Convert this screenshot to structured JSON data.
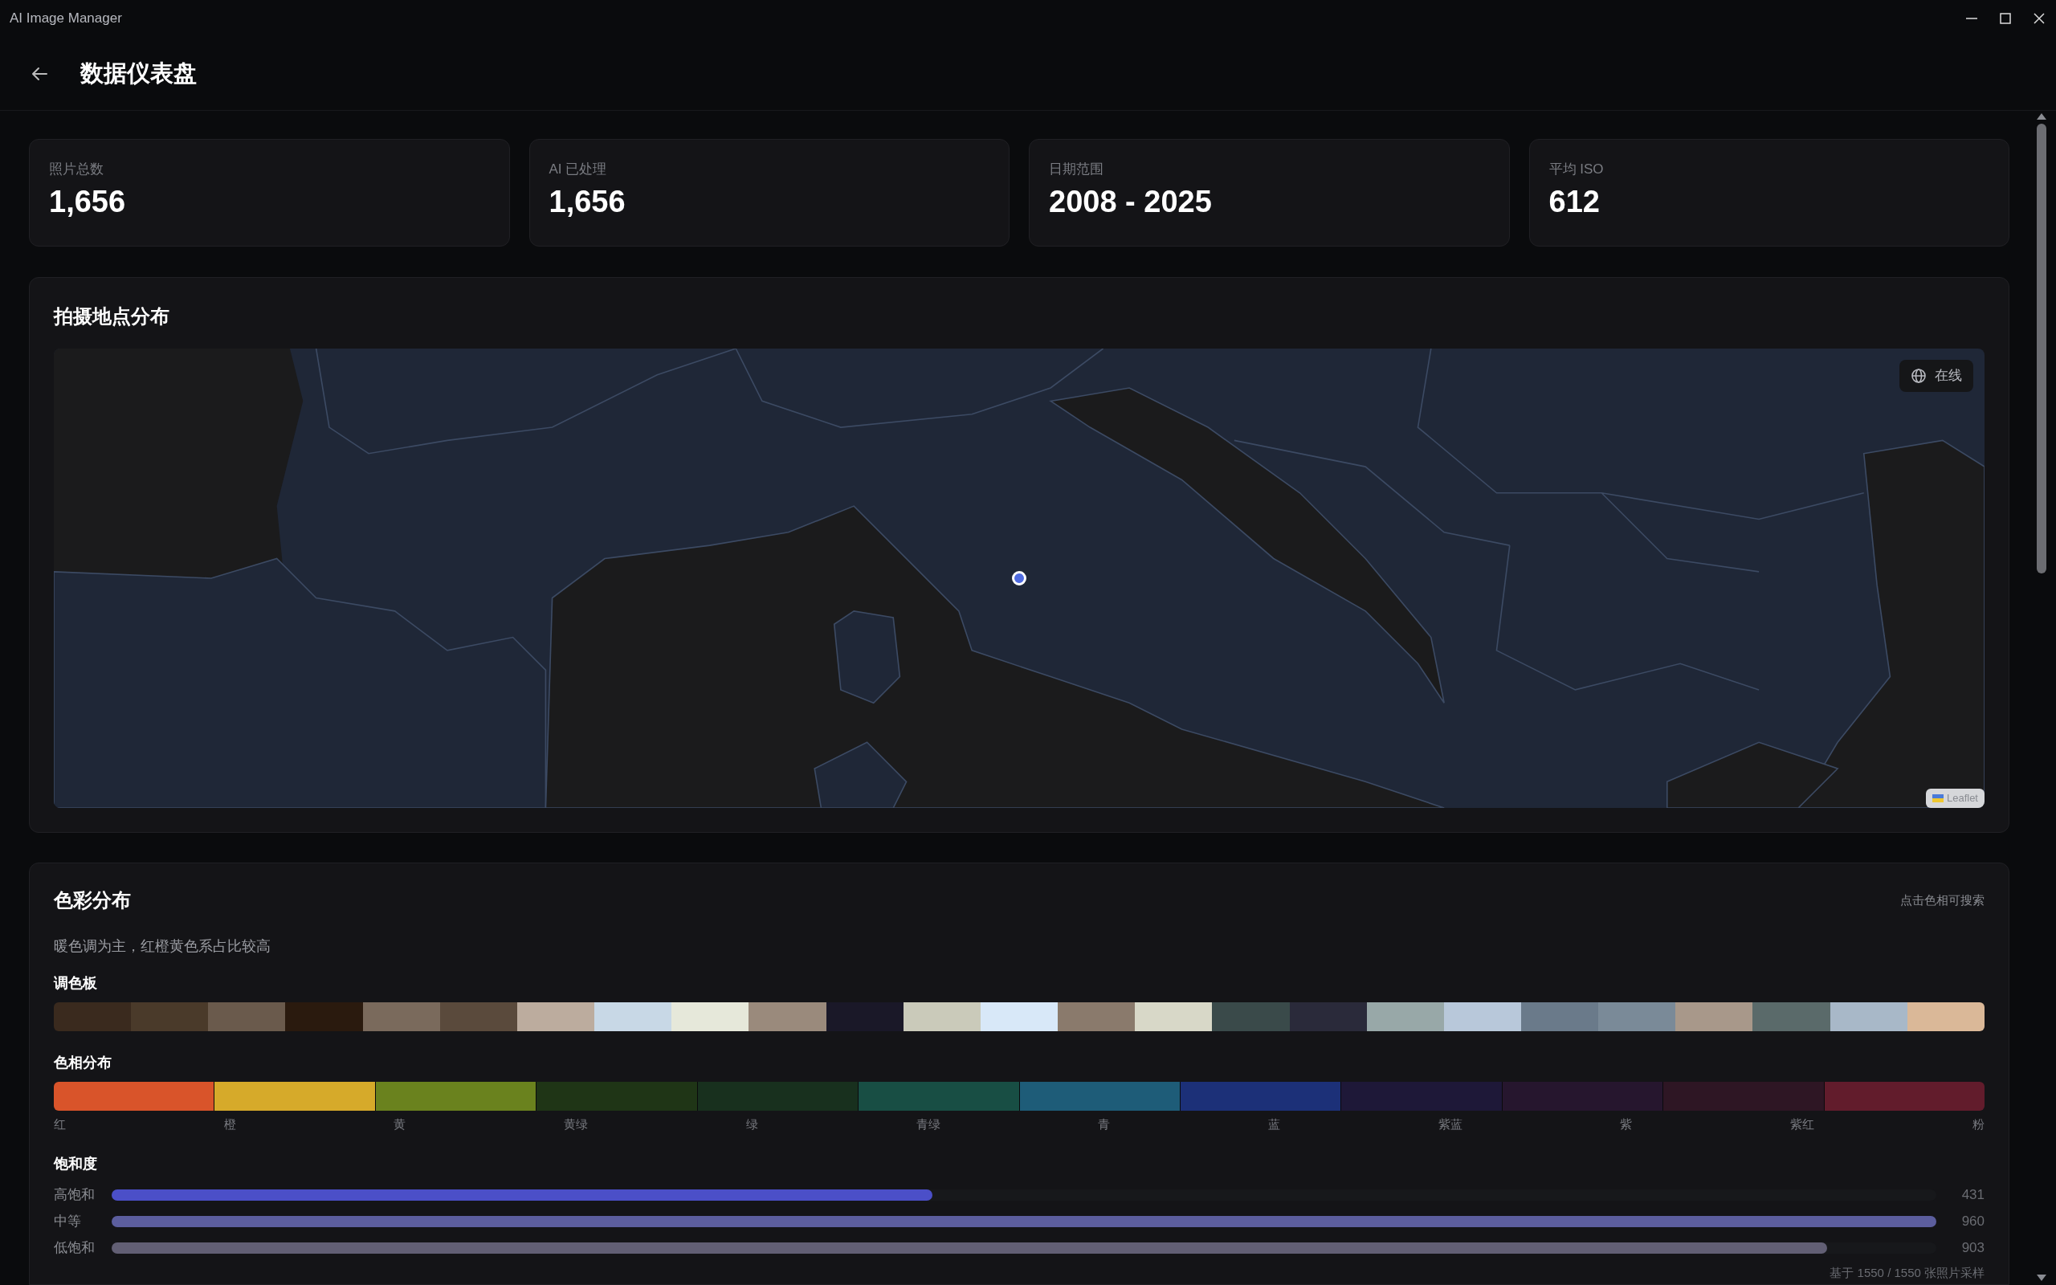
{
  "window": {
    "title": "AI Image Manager"
  },
  "header": {
    "title": "数据仪表盘"
  },
  "stats": [
    {
      "label": "照片总数",
      "value": "1,656"
    },
    {
      "label": "AI 已处理",
      "value": "1,656"
    },
    {
      "label": "日期范围",
      "value": "2008 - 2025"
    },
    {
      "label": "平均 ISO",
      "value": "612"
    }
  ],
  "map_card": {
    "title": "拍摄地点分布",
    "mode_button": "在线",
    "attribution": "Leaflet"
  },
  "color_card": {
    "title": "色彩分布",
    "hint": "点击色相可搜索",
    "summary": "暖色调为主，红橙黄色系占比较高",
    "palette": {
      "title": "调色板",
      "swatches": [
        {
          "color": "#3a2a1e"
        },
        {
          "color": "#4a3a2a"
        },
        {
          "color": "#6a5a4c"
        },
        {
          "color": "#2a1a0e"
        },
        {
          "color": "#7a6a5c"
        },
        {
          "color": "#5a4a3c"
        },
        {
          "color": "#bcac9e"
        },
        {
          "color": "#c8d8e6"
        },
        {
          "color": "#e6e8da"
        },
        {
          "color": "#9a8a7c"
        },
        {
          "color": "#1a1828"
        },
        {
          "color": "#cacaba"
        },
        {
          "color": "#d8e8f8"
        },
        {
          "color": "#8a7a6c"
        },
        {
          "color": "#d8d8c8"
        },
        {
          "color": "#3a4a4a"
        },
        {
          "color": "#2a2a3a"
        },
        {
          "color": "#98a8a8"
        },
        {
          "color": "#b8c8da"
        },
        {
          "color": "#6a7a8a"
        },
        {
          "color": "#7a8a98"
        },
        {
          "color": "#a8988a"
        },
        {
          "color": "#5a6a6a"
        },
        {
          "color": "#a8b8c8"
        },
        {
          "color": "#dab898"
        }
      ]
    },
    "hue": {
      "title": "色相分布",
      "segments": [
        {
          "label": "红",
          "color": "#d9542a"
        },
        {
          "label": "橙",
          "color": "#d6aa2a"
        },
        {
          "label": "黄",
          "color": "#6a821e"
        },
        {
          "label": "黄绿",
          "color": "#1f3516"
        },
        {
          "label": "绿",
          "color": "#18301e"
        },
        {
          "label": "青绿",
          "color": "#184e44"
        },
        {
          "label": "青",
          "color": "#1e5c78"
        },
        {
          "label": "蓝",
          "color": "#1c3078"
        },
        {
          "label": "紫蓝",
          "color": "#1e1838"
        },
        {
          "label": "紫",
          "color": "#26162e"
        },
        {
          "label": "紫红",
          "color": "#2e1624"
        },
        {
          "label": "粉",
          "color": "#621c2c"
        }
      ]
    },
    "saturation": {
      "title": "饱和度",
      "rows": [
        {
          "label": "高饱和",
          "level": 0.45,
          "count": "431",
          "color": "#4b4fc8"
        },
        {
          "label": "中等",
          "level": 1.0,
          "count": "960",
          "color": "#5c5e9e"
        },
        {
          "label": "低饱和",
          "level": 0.94,
          "count": "903",
          "color": "#625f74"
        }
      ]
    },
    "footnote": "基于 1550 / 1550 张照片采样"
  }
}
